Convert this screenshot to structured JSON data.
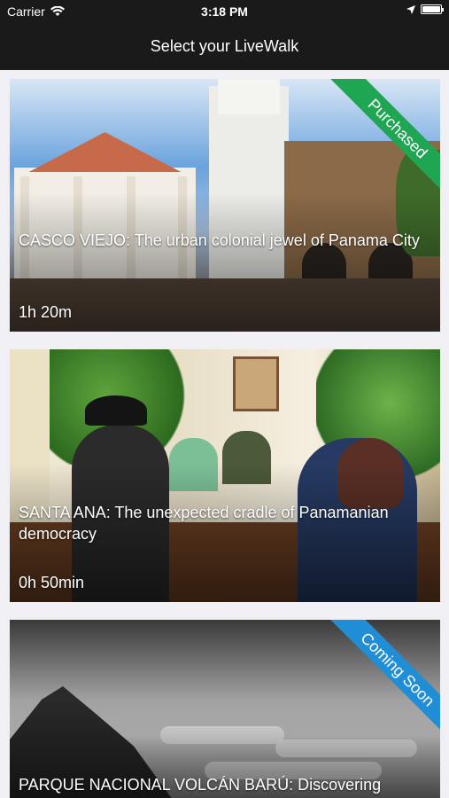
{
  "status_bar": {
    "carrier": "Carrier",
    "time": "3:18 PM"
  },
  "nav": {
    "title": "Select your LiveWalk"
  },
  "walks": [
    {
      "title": "CASCO VIEJO: The urban colonial jewel of Panama City",
      "duration": "1h 20m",
      "badge": "Purchased",
      "badge_color": "#1fa653"
    },
    {
      "title": "SANTA ANA: The unexpected cradle of Panamanian democracy",
      "duration": "0h 50min",
      "badge": "",
      "badge_color": ""
    },
    {
      "title": "PARQUE NACIONAL VOLCÁN BARÚ: Discovering",
      "duration": "",
      "badge": "Coming Soon",
      "badge_color": "#1f8ed6"
    }
  ]
}
